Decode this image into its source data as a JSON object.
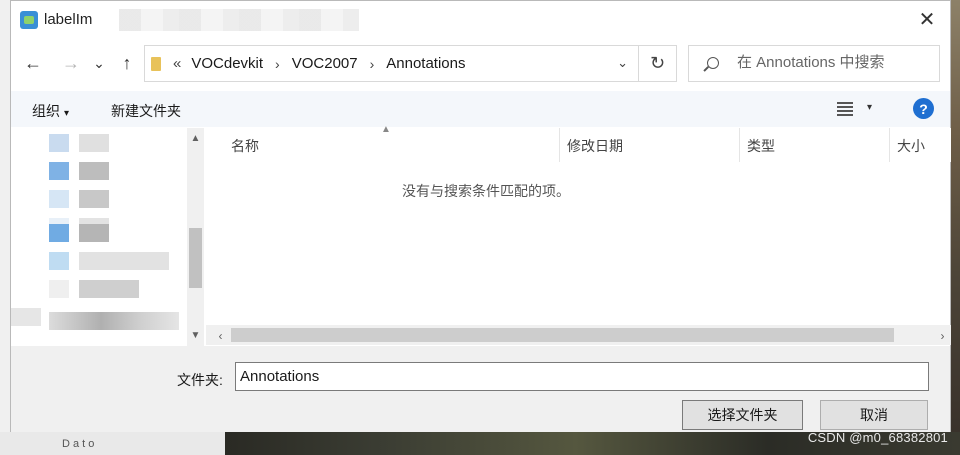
{
  "window": {
    "title": "labelIm",
    "close_glyph": "✕"
  },
  "nav": {
    "back_glyph": "←",
    "forward_glyph": "→",
    "recent_glyph": "⌄",
    "up_glyph": "↑"
  },
  "address": {
    "lead": "«",
    "crumbs": [
      "VOCdevkit",
      "VOC2007",
      "Annotations"
    ],
    "sep": "›",
    "dropdown_glyph": "⌄",
    "refresh_glyph": "↻"
  },
  "search": {
    "placeholder": "在 Annotations 中搜索"
  },
  "toolbar": {
    "organize": "组织",
    "new_folder": "新建文件夹",
    "dd_glyph": "▾",
    "help": "?"
  },
  "columns": {
    "name": "名称",
    "modified": "修改日期",
    "type": "类型",
    "size": "大小"
  },
  "list": {
    "empty_message": "没有与搜索条件匹配的项。"
  },
  "scroll": {
    "up": "▲",
    "down": "▼",
    "left": "‹",
    "right": "›"
  },
  "bottom": {
    "folder_label": "文件夹:",
    "folder_value": "Annotations",
    "select_button": "选择文件夹",
    "cancel_button": "取消"
  },
  "watermark": "CSDN @m0_68382801",
  "background_label": "D a t o"
}
